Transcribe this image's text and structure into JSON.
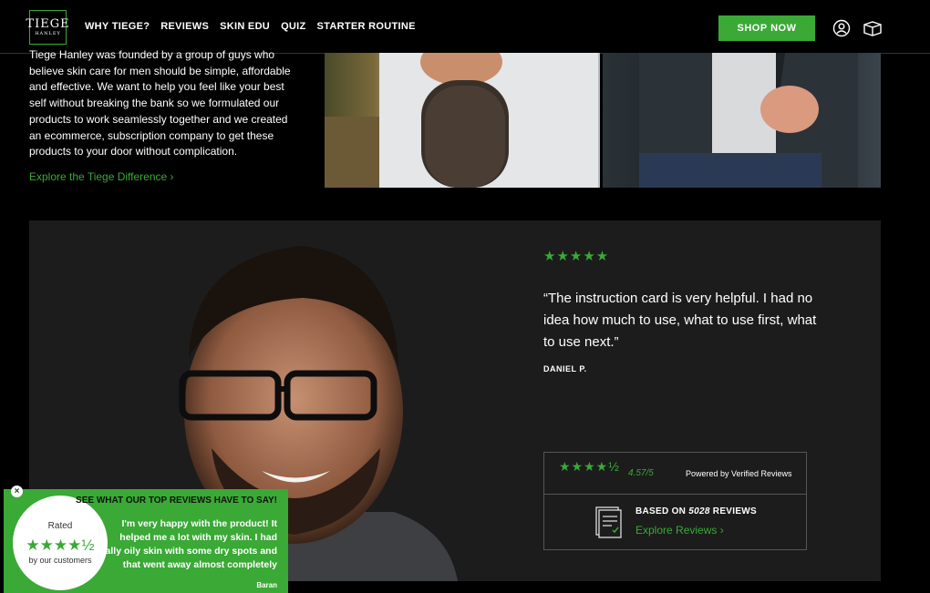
{
  "header": {
    "logo_line1": "TIEGE",
    "logo_line2": "HANLEY",
    "nav": [
      "WHY TIEGE?",
      "REVIEWS",
      "SKIN EDU",
      "QUIZ",
      "STARTER ROUTINE"
    ],
    "shop_label": "SHOP NOW"
  },
  "about": {
    "text": "Tiege Hanley was founded by a group of guys who believe skin care for men should be simple, affordable and effective. We want to help you feel like your best self without breaking the bank so we formulated our products to work seamlessly together and we created an ecommerce, subscription company to get these products to your door without complication.",
    "link": "Explore the Tiege Difference ›"
  },
  "review": {
    "stars": "★★★★★",
    "quote": "“The instruction card is very helpful. I had no idea how much to use, what to use first, what to use next.”",
    "author": "DANIEL P."
  },
  "summary": {
    "stars": "★★★★½",
    "score": "4.57/5",
    "powered": "Powered by Verified Reviews",
    "based_prefix": "BASED ON ",
    "count": "5028",
    "based_suffix": " REVIEWS",
    "link": "Explore Reviews ›"
  },
  "popup": {
    "rated": "Rated",
    "stars": "★★★★½",
    "by": "by our customers",
    "heading": "SEE WHAT OUR TOP REVIEWS HAVE TO SAY!",
    "text": "I'm very happy with the product! It helped me a lot with my skin. I had really oily skin with some dry spots and that went away almost completely",
    "name": "Baran",
    "close": "×"
  },
  "colors": {
    "accent": "#3aa936",
    "card": "#1c1c1c"
  }
}
